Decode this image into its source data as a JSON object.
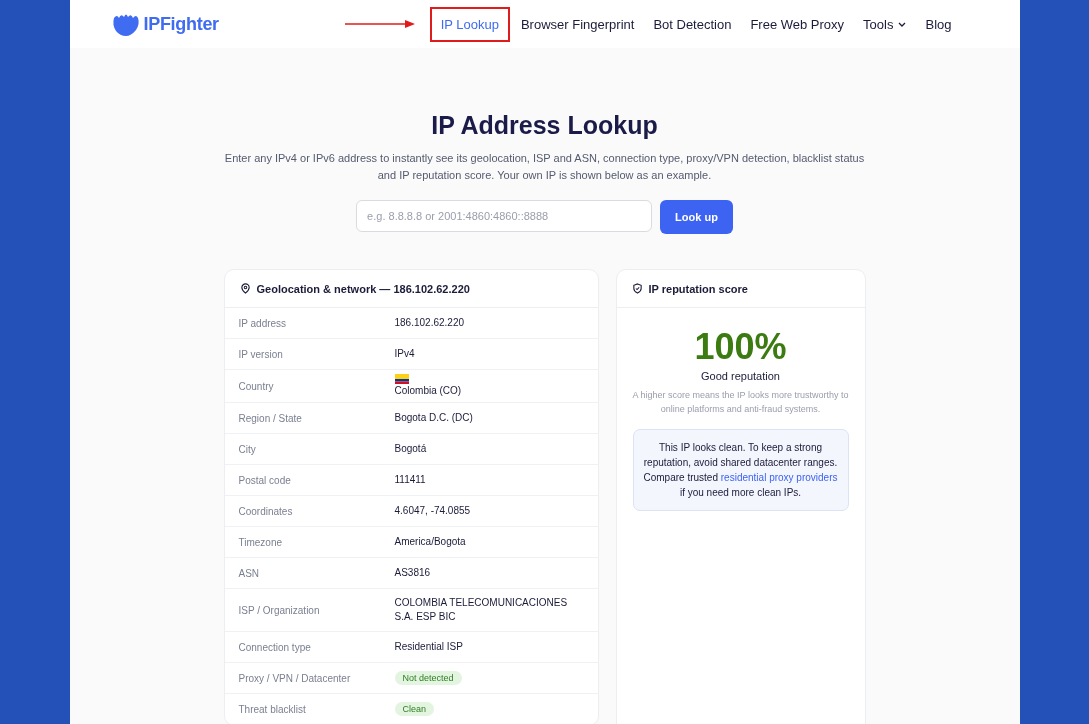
{
  "brand": {
    "name": "IPFighter"
  },
  "nav": [
    {
      "label": "IP Lookup",
      "selected": true,
      "annotated": true,
      "dropdown": false
    },
    {
      "label": "Browser Fingerprint",
      "selected": false,
      "annotated": false,
      "dropdown": false
    },
    {
      "label": "Bot Detection",
      "selected": false,
      "annotated": false,
      "dropdown": false
    },
    {
      "label": "Free Web Proxy",
      "selected": false,
      "annotated": false,
      "dropdown": false
    },
    {
      "label": "Tools",
      "selected": false,
      "annotated": false,
      "dropdown": true
    },
    {
      "label": "Blog",
      "selected": false,
      "annotated": false,
      "dropdown": false
    }
  ],
  "hero": {
    "title": "IP Address Lookup",
    "description": "Enter any IPv4 or IPv6 address to instantly see its geolocation, ISP and ASN, connection type, proxy/VPN detection, blacklist status and IP reputation score. Your own IP is shown below as an example.",
    "search": {
      "placeholder": "e.g. 8.8.8.8 or 2001:4860:4860::8888"
    },
    "button": "Look up"
  },
  "geo_card": {
    "title": "Geolocation & network — 186.102.62.220",
    "rows": [
      {
        "label": "IP address",
        "kind": "text",
        "value": "186.102.62.220"
      },
      {
        "label": "IP version",
        "kind": "text",
        "value": "IPv4"
      },
      {
        "label": "Country",
        "kind": "country",
        "value": "Colombia (CO)"
      },
      {
        "label": "Region / State",
        "kind": "text",
        "value": "Bogota D.C. (DC)"
      },
      {
        "label": "City",
        "kind": "text",
        "value": "Bogotá"
      },
      {
        "label": "Postal code",
        "kind": "text",
        "value": "111411"
      },
      {
        "label": "Coordinates",
        "kind": "text",
        "value": "4.6047, -74.0855"
      },
      {
        "label": "Timezone",
        "kind": "text",
        "value": "America/Bogota"
      },
      {
        "label": "ASN",
        "kind": "text",
        "value": "AS3816"
      },
      {
        "label": "ISP / Organization",
        "kind": "text",
        "value": "COLOMBIA TELECOMUNICACIONES S.A. ESP BIC"
      },
      {
        "label": "Connection type",
        "kind": "text",
        "value": "Residential ISP"
      },
      {
        "label": "Proxy / VPN / Datacenter",
        "kind": "badge",
        "value": "Not detected",
        "color": "#e3f5e1"
      },
      {
        "label": "Threat blacklist",
        "kind": "badge",
        "value": "Clean",
        "color": "#e3f5e1"
      }
    ]
  },
  "reputation_card": {
    "title": "IP reputation score",
    "score": "100%",
    "verdict": "Good reputation",
    "explanation": "A higher score means the IP looks more trustworthy to online platforms and anti-fraud systems.",
    "note": {
      "text_before": "This IP looks clean. To keep a strong reputation, avoid shared datacenter ranges. Compare trusted",
      "link": "residential proxy providers",
      "text_after": "if you need more clean IPs."
    }
  }
}
